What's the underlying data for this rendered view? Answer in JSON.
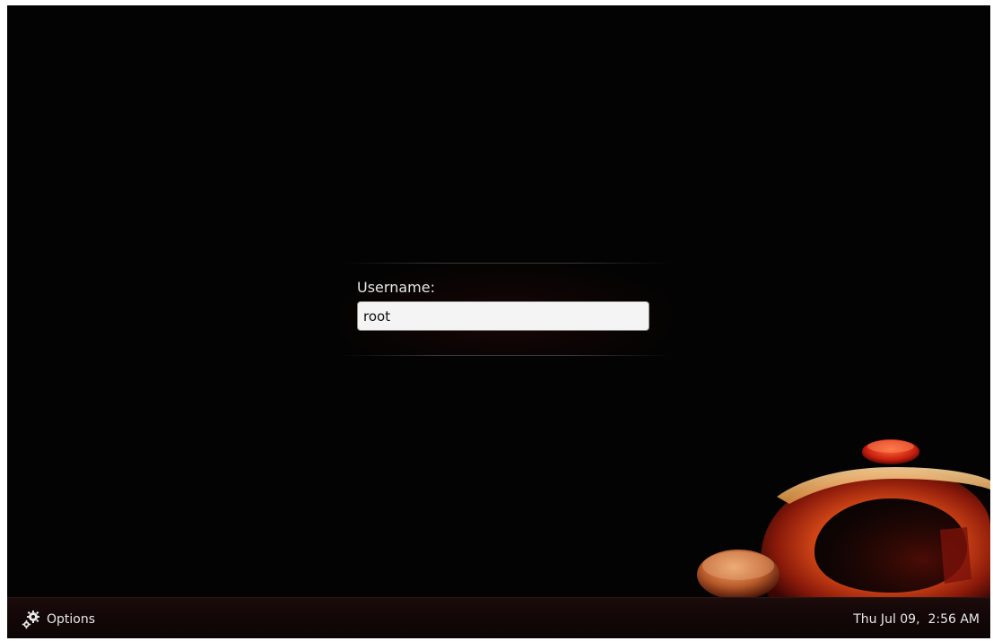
{
  "login": {
    "username_label": "Username:",
    "username_value": "root"
  },
  "bottom_panel": {
    "options_label": "Options",
    "options_icon": "gear-icon",
    "clock": "Thu Jul 09,  2:56 AM"
  },
  "theme": {
    "background": "#030303",
    "accent": "#e8501a"
  },
  "logo_icon": "ubuntu-logo"
}
